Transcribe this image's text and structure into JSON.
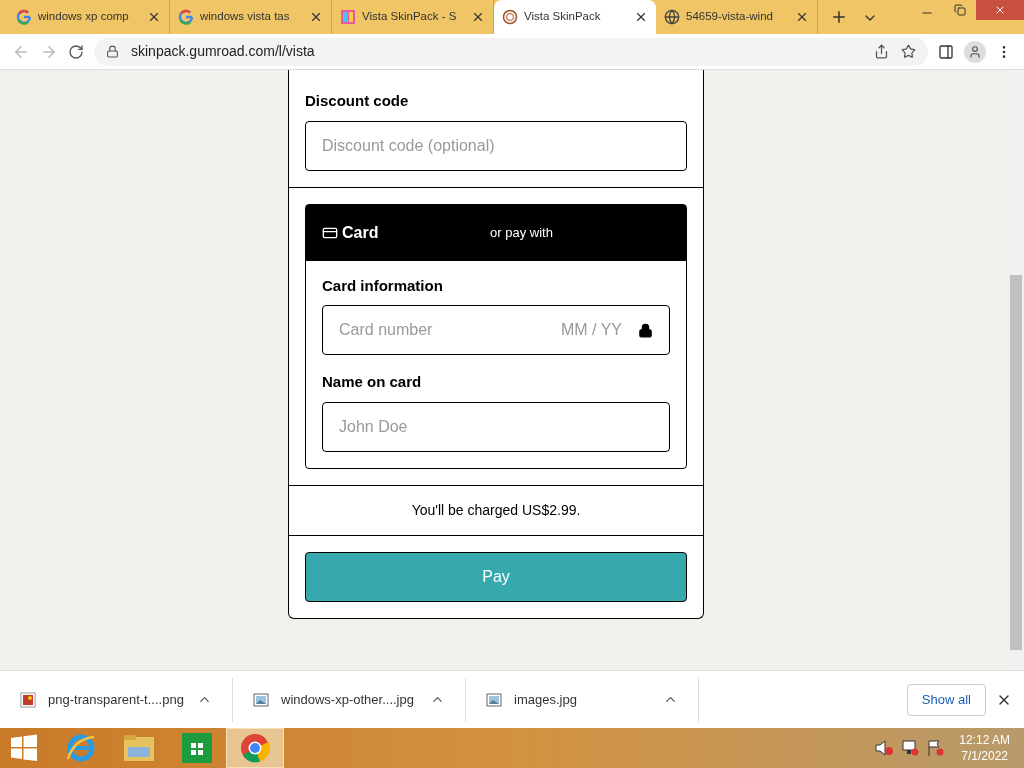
{
  "tabs": [
    {
      "title": "windows xp comp",
      "kind": "google",
      "selected": false
    },
    {
      "title": "windows vista tas",
      "kind": "google",
      "selected": false
    },
    {
      "title": "Vista SkinPack - S",
      "kind": "sp",
      "selected": false
    },
    {
      "title": "Vista SkinPack",
      "kind": "spiral",
      "selected": true
    },
    {
      "title": "54659-vista-wind",
      "kind": "globe",
      "selected": false
    }
  ],
  "address": "skinpack.gumroad.com/l/vista",
  "form": {
    "discount_label": "Discount code",
    "discount_placeholder": "Discount code (optional)",
    "payment_tabs": [
      {
        "label": "Card",
        "selected": true
      },
      {
        "label": "or pay with",
        "selected": false
      }
    ],
    "card_info_label": "Card information",
    "card_number_placeholder": "Card number",
    "expiry_placeholder": "MM / YY",
    "name_label": "Name on card",
    "name_placeholder": "John Doe",
    "charge_note": "You'll be charged US$2.99.",
    "pay_button": "Pay"
  },
  "downloads": [
    {
      "name": "png-transparent-t....png",
      "kind": "image"
    },
    {
      "name": "windows-xp-other....jpg",
      "kind": "photo"
    },
    {
      "name": "images.jpg",
      "kind": "photo"
    }
  ],
  "show_all": "Show all",
  "taskbar": {
    "apps": [
      {
        "kind": "ie",
        "selected": false
      },
      {
        "kind": "explorer",
        "selected": false
      },
      {
        "kind": "store",
        "selected": false
      },
      {
        "kind": "chrome",
        "selected": true
      }
    ],
    "time": "12:12 AM",
    "date": "7/1/2022"
  }
}
